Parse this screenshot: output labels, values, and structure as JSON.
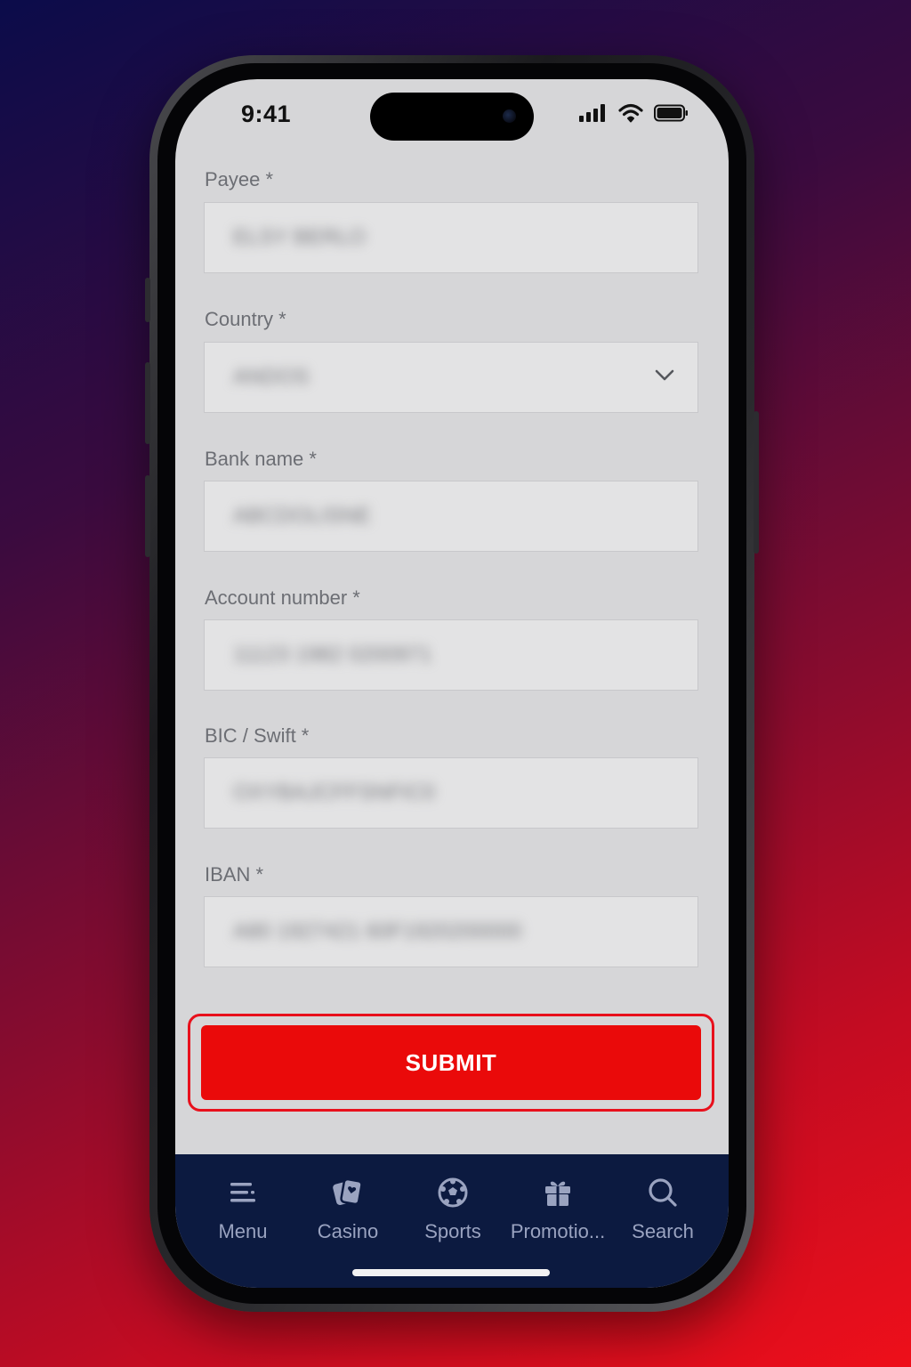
{
  "status_bar": {
    "time": "9:41"
  },
  "form": {
    "fields": [
      {
        "label": "Payee *",
        "value": "ELSY BERLO",
        "type": "text"
      },
      {
        "label": "Country *",
        "value": "ANDOS",
        "type": "select"
      },
      {
        "label": "Bank name *",
        "value": "ABCDOLISNE",
        "type": "text"
      },
      {
        "label": "Account number *",
        "value": "11123 1982 0200971",
        "type": "text"
      },
      {
        "label": "BIC / Swift *",
        "value": "OXYBAJCFFSNFIC0",
        "type": "text"
      },
      {
        "label": "IBAN *",
        "value": "A80 1927421 60F1920200000",
        "type": "text"
      }
    ],
    "submit_label": "SUBMIT"
  },
  "bottom_nav": {
    "items": [
      {
        "label": "Menu",
        "icon": "menu-icon"
      },
      {
        "label": "Casino",
        "icon": "casino-cards-icon"
      },
      {
        "label": "Sports",
        "icon": "soccer-ball-icon"
      },
      {
        "label": "Promotio...",
        "icon": "gift-icon"
      },
      {
        "label": "Search",
        "icon": "search-icon"
      }
    ]
  },
  "colors": {
    "accent": "#ea0a0a",
    "nav_background": "#0c1a40",
    "screen_background": "#d6d6d8"
  }
}
